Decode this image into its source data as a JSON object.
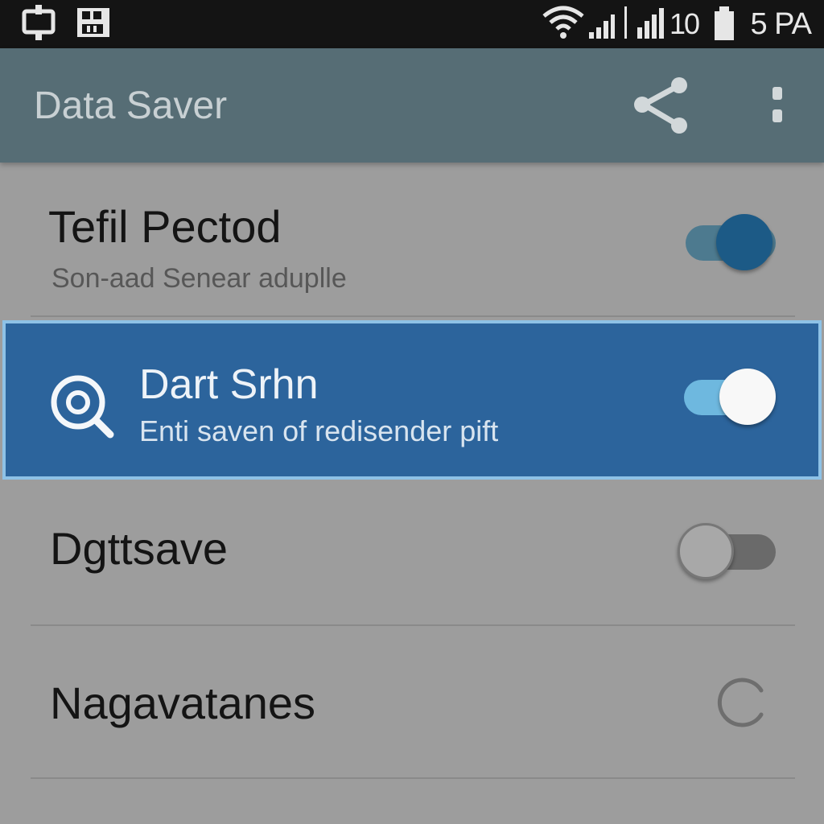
{
  "status_bar": {
    "level": "10",
    "time": "5 PA",
    "icons": [
      "cast-icon",
      "sim-card-icon",
      "wifi-icon",
      "signal-small-icon",
      "signal-icon",
      "battery-icon"
    ]
  },
  "app_bar": {
    "title": "Data Saver",
    "icons": [
      "share-icon",
      "overflow-menu-icon"
    ],
    "color": "#566d75"
  },
  "settings": [
    {
      "title": "Tefil Pectod",
      "subtitle": "Son-aad Senear aduplle",
      "toggle_on": true
    },
    {
      "title": "Dart Srhn",
      "subtitle": "Enti saven of redisender pift",
      "icon": "target-search-icon",
      "toggle_on": true,
      "highlighted": true,
      "highlight_color": "#2c649c"
    },
    {
      "title": "Dgttsave",
      "toggle_on": false
    },
    {
      "title": "Nagavatanes",
      "control": "radio-ring-icon"
    }
  ],
  "colors": {
    "background": "#9d9d9d",
    "accent": "#6eb8df"
  }
}
